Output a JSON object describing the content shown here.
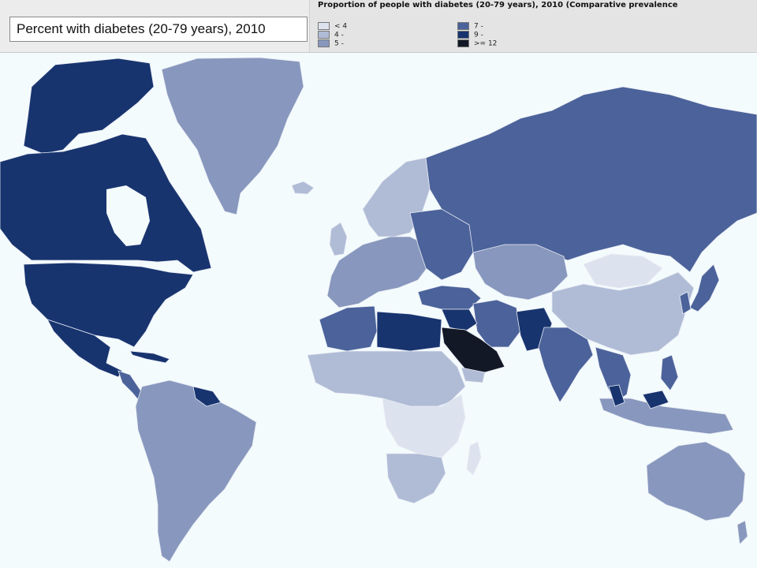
{
  "indicator_selector": {
    "selected": "Percent with diabetes (20-79 years), 2010"
  },
  "legend": {
    "title": "Proportion of people with diabetes (20-79 years), 2010 (Comparative prevalence",
    "classes": [
      {
        "label": "< 4",
        "color": "#dde3ee"
      },
      {
        "label": "4 -",
        "color": "#b0bcd6"
      },
      {
        "label": "5 -",
        "color": "#8897bd"
      },
      {
        "label": "7 -",
        "color": "#4b629a"
      },
      {
        "label": "9 -",
        "color": "#18346f"
      },
      {
        "label": ">= 12",
        "color": "#121826"
      }
    ]
  },
  "map": {
    "ocean_color": "#f4fbfd",
    "border_color": "#e8ecf4"
  }
}
